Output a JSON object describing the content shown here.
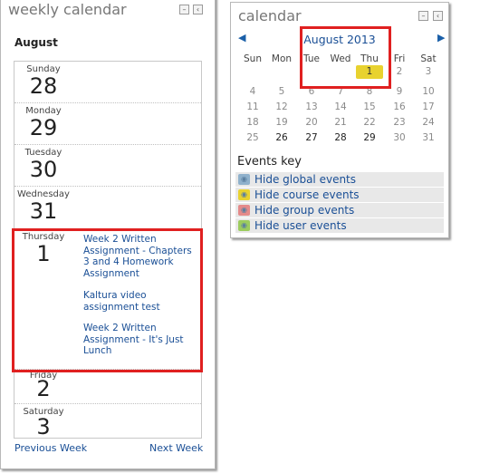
{
  "weekly": {
    "title": "weekly calendar",
    "month": "August",
    "days": [
      {
        "name": "Sunday",
        "num": "28"
      },
      {
        "name": "Monday",
        "num": "29"
      },
      {
        "name": "Tuesday",
        "num": "30"
      },
      {
        "name": "Wednesday",
        "num": "31"
      },
      {
        "name": "Thursday",
        "num": "1"
      },
      {
        "name": "Friday",
        "num": "2"
      },
      {
        "name": "Saturday",
        "num": "3"
      }
    ],
    "events": [
      "Week 2 Written Assignment - Chapters 3 and 4 Homework Assignment",
      "Kaltura video assignment test",
      "Week 2 Written Assignment - It's Just Lunch"
    ],
    "prev": "Previous Week",
    "next": "Next Week"
  },
  "calendar": {
    "title": "calendar",
    "month": "August 2013",
    "prev_icon": "left-arrow-icon",
    "next_icon": "right-arrow-icon",
    "weekdays": [
      "Sun",
      "Mon",
      "Tue",
      "Wed",
      "Thu",
      "Fri",
      "Sat"
    ],
    "weeks": [
      [
        "",
        "",
        "",
        "",
        "1",
        "2",
        "3"
      ],
      [
        "4",
        "5",
        "6",
        "7",
        "8",
        "9",
        "10"
      ],
      [
        "11",
        "12",
        "13",
        "14",
        "15",
        "16",
        "17"
      ],
      [
        "18",
        "19",
        "20",
        "21",
        "22",
        "23",
        "24"
      ],
      [
        "25",
        "26",
        "27",
        "28",
        "29",
        "30",
        "31"
      ]
    ],
    "today": "1",
    "current_day": "26",
    "events_key_title": "Events key",
    "events_key": [
      {
        "label": "Hide global events",
        "color": "#8fb1cc"
      },
      {
        "label": "Hide course events",
        "color": "#e8d22f"
      },
      {
        "label": "Hide group events",
        "color": "#e48a8a"
      },
      {
        "label": "Hide user events",
        "color": "#9ccc5e"
      }
    ]
  },
  "colors": {
    "highlight": "#e02020",
    "link": "#1a4f96",
    "today": "#e8d22f"
  }
}
